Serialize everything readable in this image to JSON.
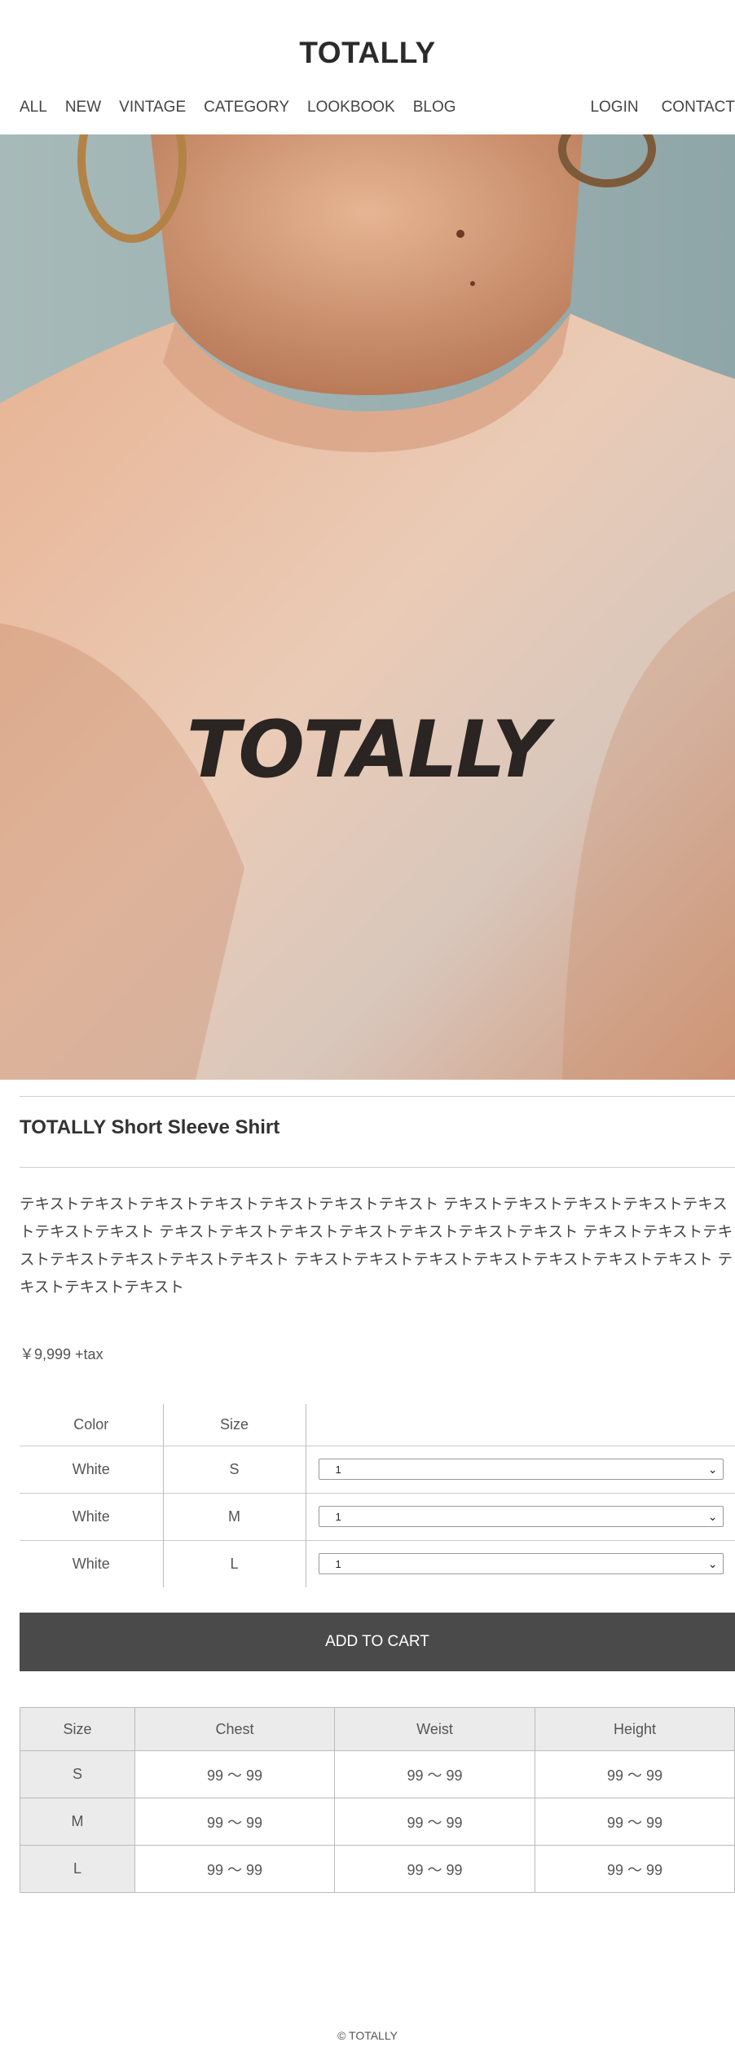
{
  "header": {
    "logo": "TOTALLY",
    "nav_left": [
      "ALL",
      "NEW",
      "VINTAGE",
      "CATEGORY",
      "LOOKBOOK",
      "BLOG"
    ],
    "nav_right": [
      "LOGIN",
      "CONTACT"
    ]
  },
  "hero": {
    "shirt_print": "TOTALLY"
  },
  "product": {
    "title": "TOTALLY Short Sleeve Shirt",
    "description": "テキストテキストテキストテキストテキストテキストテキスト テキストテキストテキストテキストテキストテキストテキスト テキストテキストテキストテキストテキストテキストテキスト テキストテキストテキストテキストテキストテキストテキスト テキストテキストテキストテキストテキストテキストテキスト テキストテキストテキスト",
    "price": "￥9,999 +tax"
  },
  "variants": {
    "headers": [
      "Color",
      "Size",
      ""
    ],
    "rows": [
      {
        "color": "White",
        "size": "S",
        "qty": "1"
      },
      {
        "color": "White",
        "size": "M",
        "qty": "1"
      },
      {
        "color": "White",
        "size": "L",
        "qty": "1"
      }
    ]
  },
  "cart": {
    "button_label": "ADD TO CART"
  },
  "size_chart": {
    "headers": [
      "Size",
      "Chest",
      "Weist",
      "Height"
    ],
    "rows": [
      {
        "size": "S",
        "chest": "99 〜 99",
        "weist": "99 〜 99",
        "height": "99 〜 99"
      },
      {
        "size": "M",
        "chest": "99 〜 99",
        "weist": "99 〜 99",
        "height": "99 〜 99"
      },
      {
        "size": "L",
        "chest": "99 〜 99",
        "weist": "99 〜 99",
        "height": "99 〜 99"
      }
    ]
  },
  "footer": {
    "copyright": "© TOTALLY"
  },
  "colors": {
    "button_bg": "#4a4a4a",
    "table_header_bg": "#ebebeb",
    "text": "#333333"
  }
}
